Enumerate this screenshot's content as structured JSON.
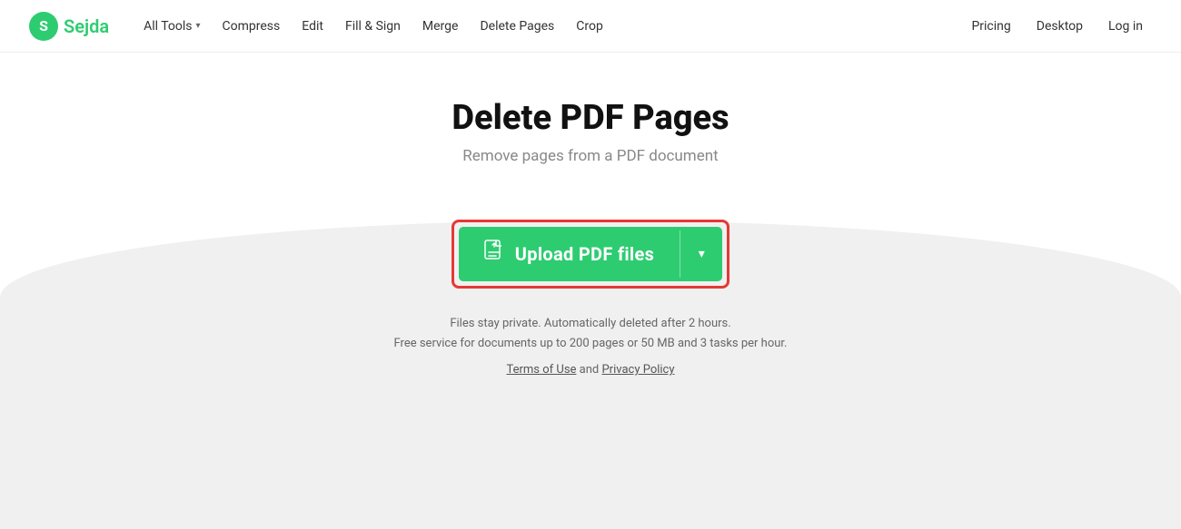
{
  "header": {
    "logo_letter": "S",
    "logo_name": "Sejda",
    "nav_items": [
      {
        "label": "All Tools",
        "has_chevron": true
      },
      {
        "label": "Compress",
        "has_chevron": false
      },
      {
        "label": "Edit",
        "has_chevron": false
      },
      {
        "label": "Fill & Sign",
        "has_chevron": false
      },
      {
        "label": "Merge",
        "has_chevron": false
      },
      {
        "label": "Delete Pages",
        "has_chevron": false
      },
      {
        "label": "Crop",
        "has_chevron": false
      }
    ],
    "nav_right": [
      {
        "label": "Pricing"
      },
      {
        "label": "Desktop"
      },
      {
        "label": "Log in"
      }
    ]
  },
  "main": {
    "title": "Delete PDF Pages",
    "subtitle": "Remove pages from a PDF document",
    "upload_button_label": "Upload PDF files",
    "privacy_line1": "Files stay private. Automatically deleted after 2 hours.",
    "privacy_line2": "Free service for documents up to 200 pages or 50 MB and 3 tasks per hour.",
    "terms_label": "Terms of Use",
    "and_text": "and",
    "privacy_label": "Privacy Policy"
  },
  "colors": {
    "green": "#2ecc71",
    "red": "#e53935",
    "text_dark": "#111",
    "text_gray": "#888",
    "bg_curve": "#f0f0f0"
  }
}
